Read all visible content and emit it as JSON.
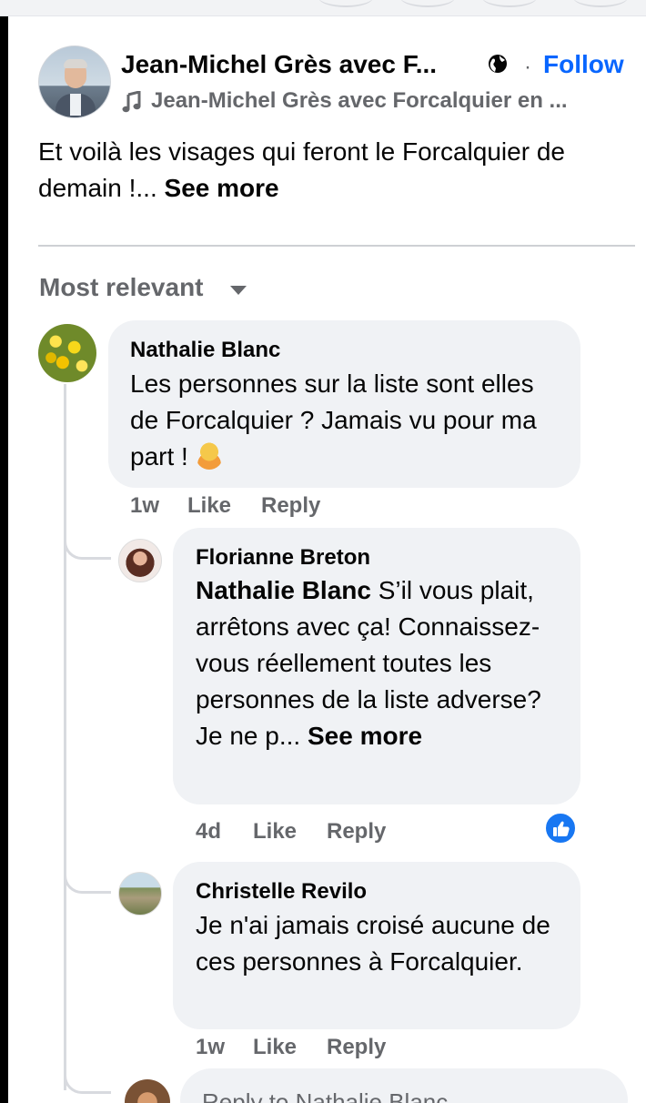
{
  "post": {
    "author": "Jean-Michel Grès avec F...",
    "follow_label": "Follow",
    "separator": "·",
    "subtitle": "Jean-Michel Grès avec Forcalquier en ...",
    "text": "Et voilà les visages qui feront le Forcalquier de demain !...",
    "see_more": "See more"
  },
  "sort": {
    "label": "Most relevant"
  },
  "comments": [
    {
      "author": "Nathalie Blanc",
      "text": "Les personnes sur la liste sont elles de Forcalquier ? Jamais vu pour ma part !",
      "emoji": "🤷",
      "time": "1w",
      "like": "Like",
      "reply": "Reply"
    },
    {
      "author": "Florianne Breton",
      "mention": "Nathalie Blanc",
      "text": "S’il vous plait, arrêtons avec ça! Connaissez-vous réellement toutes les personnes de la liste adverse? Je ne p...",
      "see_more": "See more",
      "time": "4d",
      "like": "Like",
      "reply": "Reply"
    },
    {
      "author": "Christelle Revilo",
      "text": "Je n'ai jamais croisé aucune de ces personnes à Forcalquier.",
      "time": "1w",
      "like": "Like",
      "reply": "Reply"
    }
  ],
  "reply_box": {
    "placeholder": "Reply to Nathalie Blanc..."
  },
  "icons": {
    "globe": "globe-icon",
    "music": "music-note-icon",
    "caret": "caret-down-icon",
    "like": "thumbs-up-icon"
  },
  "colors": {
    "accent": "#0866ff",
    "bubble": "#f0f2f5",
    "secondary_text": "#65676b",
    "like_badge": "#1877f2"
  }
}
